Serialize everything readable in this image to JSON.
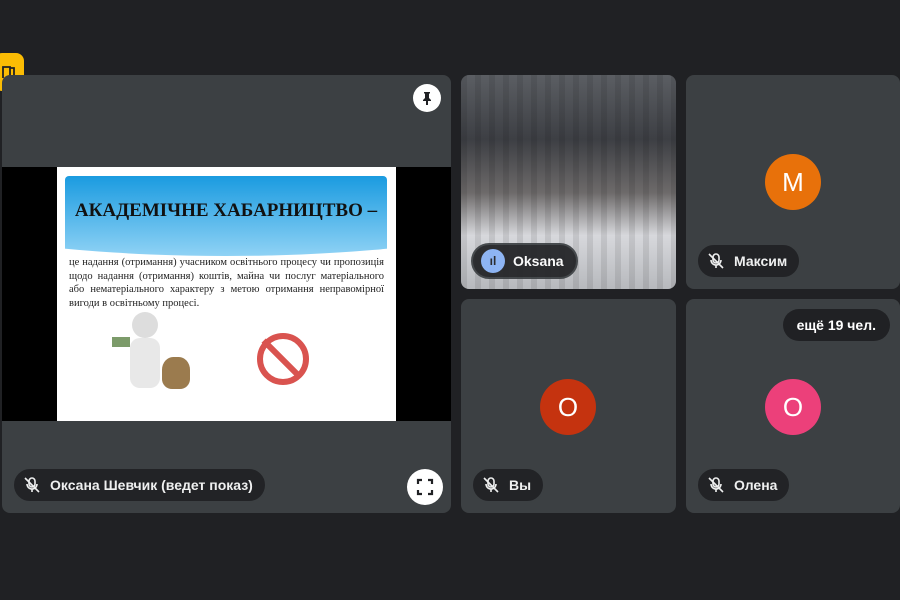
{
  "badge_icon": "door-icon",
  "presentation": {
    "presenter": "Оксана Шевчик (ведет показ)",
    "slide_title": "АКАДЕМІЧНЕ ХАБАРНИЦТВО –",
    "slide_text": "це  надання (отримання) учасником освітнього процесу чи пропозиція щодо надання (отримання) коштів, майна чи послуг матеріального або нематеріального характеру з метою отримання неправомірної вигоди в освітньому процесі."
  },
  "participants": [
    {
      "name": "Oksana",
      "initial": "",
      "color": ""
    },
    {
      "name": "Максим",
      "initial": "М",
      "color": "#e8710a"
    },
    {
      "name": "Вы",
      "initial": "О",
      "color": "#c5330f"
    },
    {
      "name": "Олена",
      "initial": "О",
      "color": "#ec407a"
    }
  ],
  "more_people": "ещё 19 чел."
}
